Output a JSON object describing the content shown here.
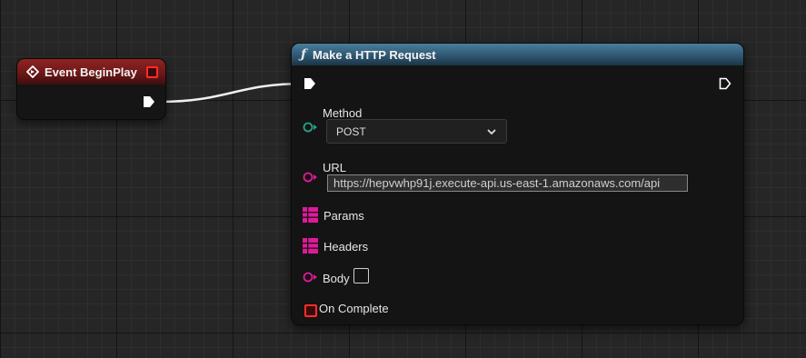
{
  "event_node": {
    "title": "Event BeginPlay"
  },
  "function_node": {
    "title": "Make a HTTP Request",
    "method": {
      "label": "Method",
      "value": "POST"
    },
    "url": {
      "label": "URL",
      "value": "https://hepvwhp91j.execute-api.us-east-1.amazonaws.com/api"
    },
    "params_label": "Params",
    "headers_label": "Headers",
    "body_label": "Body",
    "on_complete_label": "On Complete"
  },
  "colors": {
    "event_header": "#8f2424",
    "function_header": "#2e5772",
    "enum_pin": "#2aa08a",
    "struct_pin": "#e0199a",
    "delegate_pin": "#ff2d2d"
  },
  "icons": [
    "event-icon",
    "function-icon",
    "exec-pin-icon",
    "chevron-down-icon",
    "array-pin-icon",
    "delegate-pin-icon"
  ]
}
